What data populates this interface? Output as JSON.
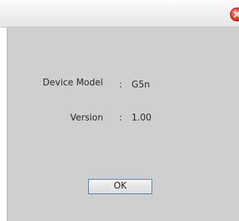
{
  "window": {
    "close_icon": "close-icon"
  },
  "info": {
    "device_model_label": "Device Model",
    "device_model_colon": ":",
    "device_model_value": "G5n",
    "version_label": "Version",
    "version_colon": ":",
    "version_value": "1.00"
  },
  "buttons": {
    "ok_label": "OK"
  },
  "colors": {
    "background": "#cfcfcf",
    "close_button": "#e8412b",
    "ok_border": "#3c7fb1"
  }
}
